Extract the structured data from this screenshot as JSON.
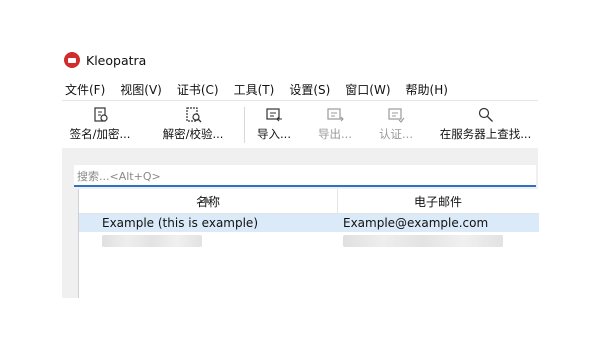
{
  "app": {
    "title": "Kleopatra"
  },
  "menu": [
    "文件(F)",
    "视图(V)",
    "证书(C)",
    "工具(T)",
    "设置(S)",
    "窗口(W)",
    "帮助(H)"
  ],
  "toolbar": [
    {
      "label": "签名/加密...",
      "icon": "sign-encrypt-icon",
      "enabled": true
    },
    {
      "label": "解密/校验...",
      "icon": "decrypt-verify-icon",
      "enabled": true
    },
    {
      "label": "导入...",
      "icon": "import-icon",
      "enabled": true
    },
    {
      "label": "导出...",
      "icon": "export-icon",
      "enabled": false
    },
    {
      "label": "认证...",
      "icon": "certify-icon",
      "enabled": false
    },
    {
      "label": "在服务器上查找...",
      "icon": "lookup-search-icon",
      "enabled": true
    }
  ],
  "search": {
    "placeholder": "搜索...<Alt+Q>"
  },
  "table": {
    "columns": [
      "名称",
      "电子邮件"
    ],
    "rows": [
      {
        "name": "Example (this is example)",
        "email": "Example@example.com",
        "selected": true
      }
    ]
  },
  "colors": {
    "accent": "#2f72c4",
    "selection": "#dbeaf8",
    "logo": "#d22b2b"
  }
}
